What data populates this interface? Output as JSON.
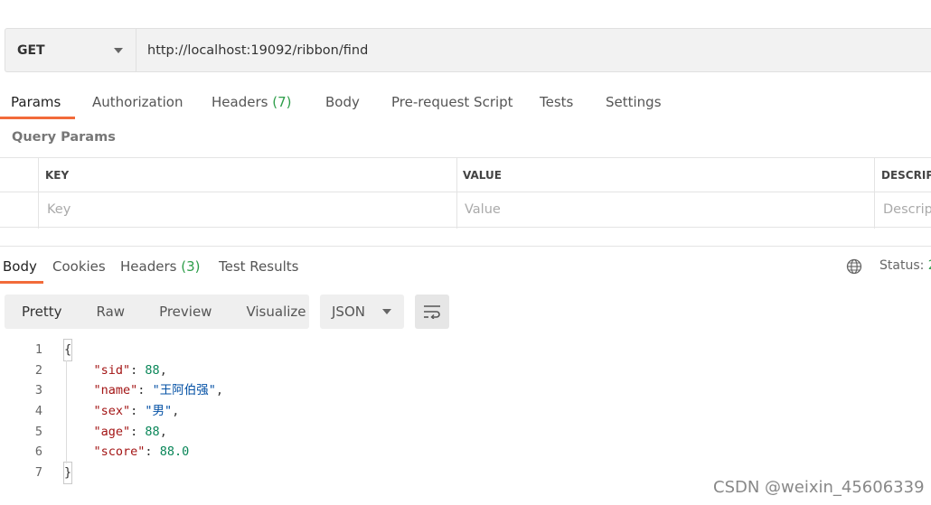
{
  "request": {
    "method": "GET",
    "url": "http://localhost:19092/ribbon/find"
  },
  "request_tabs": [
    {
      "label": "Params",
      "count": ""
    },
    {
      "label": "Authorization",
      "count": ""
    },
    {
      "label": "Headers",
      "count": "(7)"
    },
    {
      "label": "Body",
      "count": ""
    },
    {
      "label": "Pre-request Script",
      "count": ""
    },
    {
      "label": "Tests",
      "count": ""
    },
    {
      "label": "Settings",
      "count": ""
    }
  ],
  "query_params": {
    "title": "Query Params",
    "columns": [
      "KEY",
      "VALUE",
      "DESCRIPT"
    ],
    "placeholders": [
      "Key",
      "Value",
      "Descrip"
    ]
  },
  "response_tabs": [
    {
      "label": "Body",
      "count": ""
    },
    {
      "label": "Cookies",
      "count": ""
    },
    {
      "label": "Headers",
      "count": "(3)"
    },
    {
      "label": "Test Results",
      "count": ""
    }
  ],
  "response_status": {
    "label": "Status:",
    "value": "2"
  },
  "view_modes": [
    "Pretty",
    "Raw",
    "Preview",
    "Visualize"
  ],
  "format": "JSON",
  "icons": {
    "method_dropdown": "chevron-down-icon",
    "globe": "globe-icon",
    "wrap": "wrap-lines-icon"
  },
  "colors": {
    "accent": "#f26b3a",
    "count_green": "#2e9e4a"
  },
  "code": {
    "line_numbers": [
      "1",
      "2",
      "3",
      "4",
      "5",
      "6",
      "7"
    ],
    "lines": [
      [
        {
          "t": "{",
          "c": "brace-open"
        }
      ],
      [
        {
          "t": "    ",
          "c": "punct"
        },
        {
          "t": "\"sid\"",
          "c": "key"
        },
        {
          "t": ": ",
          "c": "punct"
        },
        {
          "t": "88",
          "c": "num"
        },
        {
          "t": ",",
          "c": "punct"
        }
      ],
      [
        {
          "t": "    ",
          "c": "punct"
        },
        {
          "t": "\"name\"",
          "c": "key"
        },
        {
          "t": ": ",
          "c": "punct"
        },
        {
          "t": "\"王阿伯强\"",
          "c": "str"
        },
        {
          "t": ",",
          "c": "punct"
        }
      ],
      [
        {
          "t": "    ",
          "c": "punct"
        },
        {
          "t": "\"sex\"",
          "c": "key"
        },
        {
          "t": ": ",
          "c": "punct"
        },
        {
          "t": "\"男\"",
          "c": "str"
        },
        {
          "t": ",",
          "c": "punct"
        }
      ],
      [
        {
          "t": "    ",
          "c": "punct"
        },
        {
          "t": "\"age\"",
          "c": "key"
        },
        {
          "t": ": ",
          "c": "punct"
        },
        {
          "t": "88",
          "c": "num"
        },
        {
          "t": ",",
          "c": "punct"
        }
      ],
      [
        {
          "t": "    ",
          "c": "punct"
        },
        {
          "t": "\"score\"",
          "c": "key"
        },
        {
          "t": ": ",
          "c": "punct"
        },
        {
          "t": "88.0",
          "c": "num"
        }
      ],
      [
        {
          "t": "}",
          "c": "brace-close"
        }
      ]
    ]
  },
  "watermark": "CSDN @weixin_45606339"
}
